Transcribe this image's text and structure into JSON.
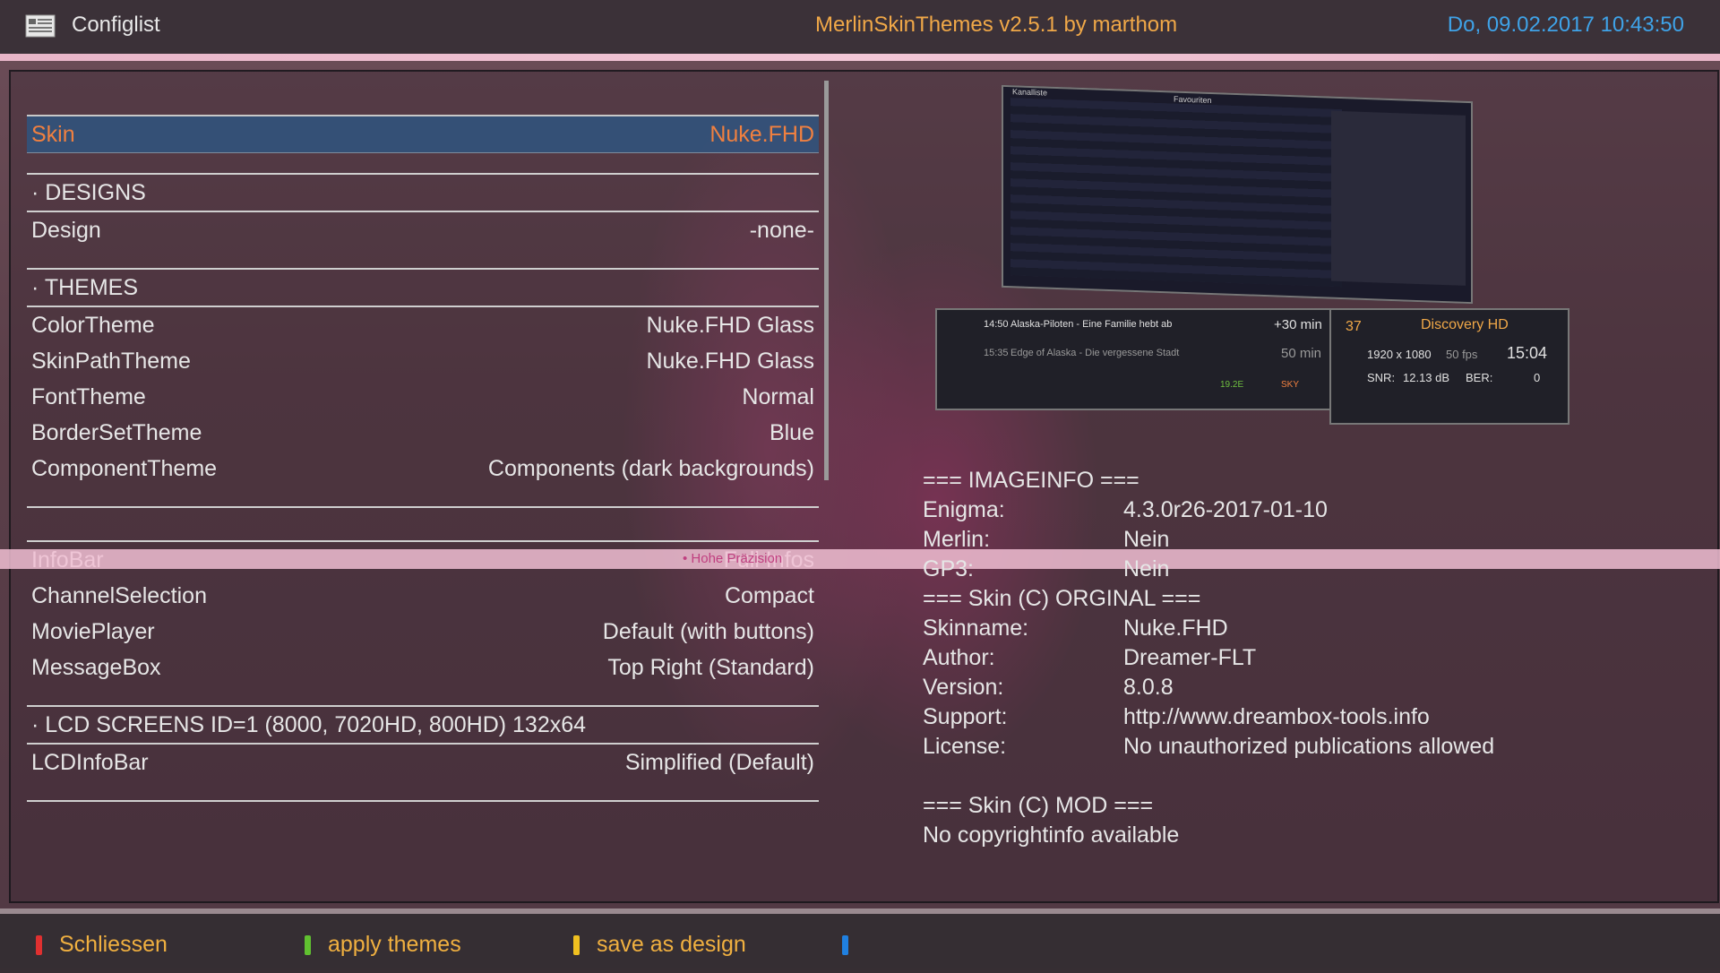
{
  "header": {
    "icon": "list-icon",
    "title": "Configlist",
    "app": "MerlinSkinThemes  v2.5.1 by marthom",
    "clock": "Do, 09.02.2017  10:43:50"
  },
  "menu": {
    "skin_label": "Skin",
    "skin_value": "Nuke.FHD",
    "designs_header": "· DESIGNS",
    "design_label": "Design",
    "design_value": "-none-",
    "themes_header": "· THEMES",
    "themes": [
      {
        "label": "ColorTheme",
        "value": "Nuke.FHD Glass"
      },
      {
        "label": "SkinPathTheme",
        "value": "Nuke.FHD Glass"
      },
      {
        "label": "FontTheme",
        "value": "Normal"
      },
      {
        "label": "BorderSetTheme",
        "value": "Blue"
      },
      {
        "label": "ComponentTheme",
        "value": "Components (dark backgrounds)"
      }
    ],
    "screens": [
      {
        "label": "InfoBar",
        "value": "Full Infos"
      },
      {
        "label": "ChannelSelection",
        "value": "Compact"
      },
      {
        "label": "MoviePlayer",
        "value": "Default (with buttons)"
      },
      {
        "label": "MessageBox",
        "value": "Top Right (Standard)"
      }
    ],
    "lcd_header": "· LCD SCREENS ID=1 (8000, 7020HD, 800HD) 132x64",
    "lcd_label": "LCDInfoBar",
    "lcd_value": "Simplified (Default)"
  },
  "overlay_text": "• Hohe Präzision",
  "preview": {
    "ch_title": "Kanalliste",
    "ch_fav": "Favouriten",
    "prog1_time": "14:50",
    "prog1_title": "Alaska-Piloten - Eine Familie hebt ab",
    "prog1_rem": "+30 min",
    "prog2_time": "15:35",
    "prog2_title": "Edge of Alaska - Die vergessene Stadt",
    "prog2_rem": "50 min",
    "ch_num": "37",
    "ch_name": "Discovery HD",
    "res": "1920 x 1080",
    "fps": "50 fps",
    "time": "15:04",
    "snr_label": "SNR:",
    "snr": "12.13 dB",
    "ber_label": "BER:",
    "ber": "0",
    "sat": "19.2E",
    "provider": "SKY"
  },
  "info": {
    "imageinfo_header": "=== IMAGEINFO ===",
    "enigma_k": "Enigma:",
    "enigma_v": "4.3.0r26-2017-01-10",
    "merlin_k": "Merlin:",
    "merlin_v": "Nein",
    "gp3_k": "GP3:",
    "gp3_v": "Nein",
    "skin_header": "=== Skin (C) ORGINAL ===",
    "skinname_k": "Skinname:",
    "skinname_v": "Nuke.FHD",
    "author_k": "Author:",
    "author_v": "Dreamer-FLT",
    "version_k": "Version:",
    "version_v": "8.0.8",
    "support_k": "Support:",
    "support_v": "http://www.dreambox-tools.info",
    "license_k": "License:",
    "license_v": "No unauthorized publications allowed",
    "mod_header": "=== Skin (C) MOD ===",
    "mod_text": "No copyrightinfo available"
  },
  "footer": {
    "red": "Schliessen",
    "green": "apply themes",
    "yellow": "save as design",
    "blue": ""
  },
  "colors": {
    "accent_orange": "#f0a848",
    "clock_blue": "#3fa3e8",
    "red": "#e03030",
    "green": "#60c030",
    "yellow": "#f0c020",
    "blue": "#2080e0"
  }
}
